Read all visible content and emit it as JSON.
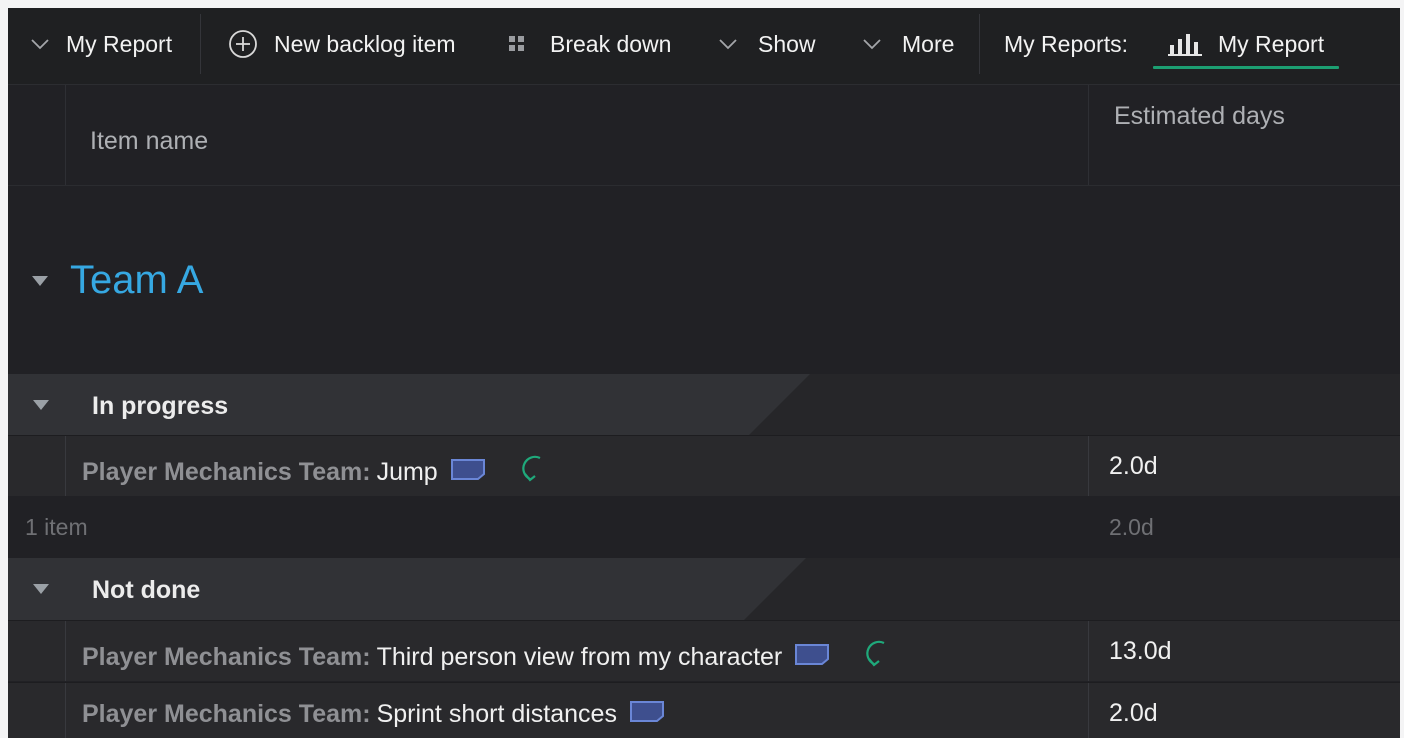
{
  "toolbar": {
    "report_label": "My Report",
    "new_backlog_label": "New backlog item",
    "break_down_label": "Break down",
    "show_label": "Show",
    "more_label": "More",
    "my_reports_label": "My Reports:",
    "active_report_label": "My Report",
    "accent_color": "#1c9f72"
  },
  "columns": {
    "item_name": "Item name",
    "estimated_days": "Estimated days"
  },
  "team": {
    "name": "Team A",
    "color": "#36a8e2"
  },
  "groups": [
    {
      "label": "In progress",
      "rows": [
        {
          "team": "Player Mechanics Team:",
          "name": "Jump",
          "estimate": "2.0d",
          "icons": [
            "card-icon",
            "cycle-icon"
          ]
        }
      ],
      "summary": {
        "count": "1 item",
        "estimate": "2.0d"
      }
    },
    {
      "label": "Not done",
      "rows": [
        {
          "team": "Player Mechanics Team:",
          "name": "Third person view from my character",
          "estimate": "13.0d",
          "icons": [
            "card-icon",
            "cycle-icon"
          ]
        },
        {
          "team": "Player Mechanics Team:",
          "name": "Sprint short distances",
          "estimate": "2.0d",
          "icons": [
            "card-icon"
          ]
        }
      ]
    }
  ]
}
